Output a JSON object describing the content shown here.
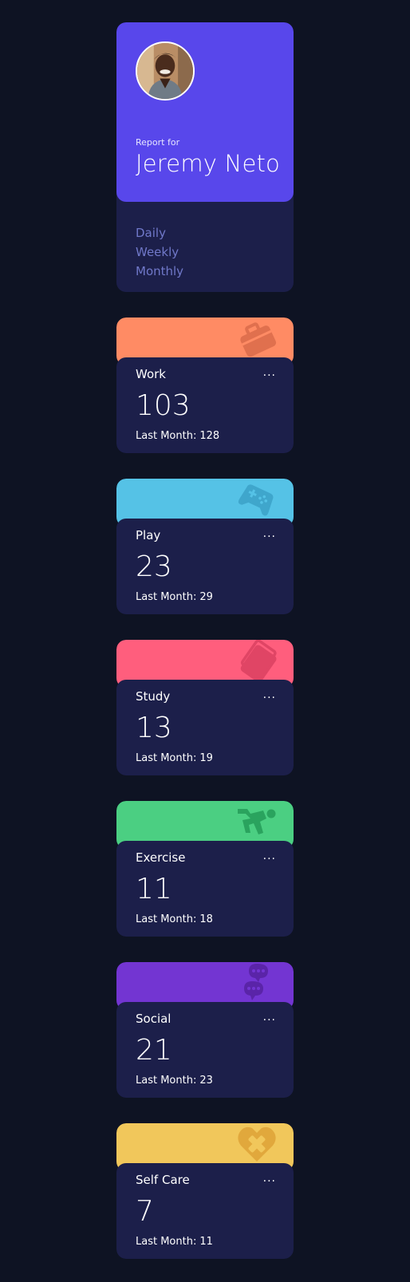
{
  "profile": {
    "report_for": "Report for",
    "name": "Jeremy Neto",
    "periods": [
      "Daily",
      "Weekly",
      "Monthly"
    ]
  },
  "colors": {
    "background": "#0e1323",
    "profile_top": "#5847eb",
    "card_body": "#1c1f4a",
    "period_text": "#7078c9"
  },
  "activities": [
    {
      "title": "Work",
      "current": "103",
      "previous_label": "Last Month:",
      "previous": "128",
      "color": "#ff8b64",
      "icon": "briefcase-icon",
      "menu": "..."
    },
    {
      "title": "Play",
      "current": "23",
      "previous_label": "Last Month:",
      "previous": "29",
      "color": "#55c2e6",
      "icon": "gamepad-icon",
      "menu": "..."
    },
    {
      "title": "Study",
      "current": "13",
      "previous_label": "Last Month:",
      "previous": "19",
      "color": "#ff5e7d",
      "icon": "books-icon",
      "menu": "..."
    },
    {
      "title": "Exercise",
      "current": "11",
      "previous_label": "Last Month:",
      "previous": "18",
      "color": "#4bcf82",
      "icon": "running-icon",
      "menu": "..."
    },
    {
      "title": "Social",
      "current": "21",
      "previous_label": "Last Month:",
      "previous": "23",
      "color": "#7335d2",
      "icon": "chat-bubbles-icon",
      "menu": "..."
    },
    {
      "title": "Self Care",
      "current": "7",
      "previous_label": "Last Month:",
      "previous": "11",
      "color": "#f1c75b",
      "icon": "heart-plus-icon",
      "menu": "..."
    }
  ]
}
